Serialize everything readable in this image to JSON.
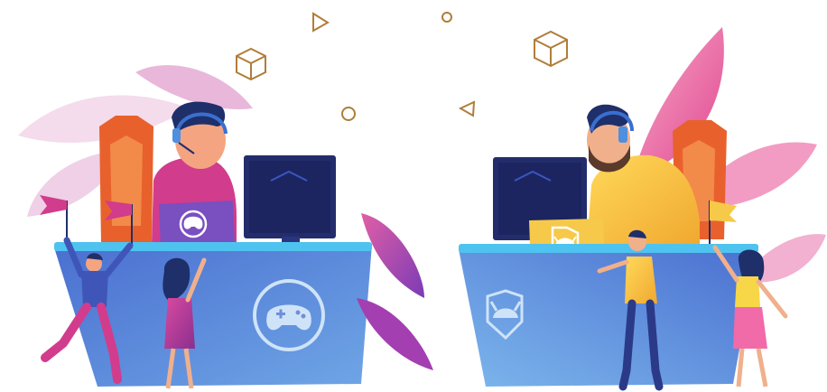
{
  "scene": {
    "description_type": "illustration",
    "teams": [
      {
        "side": "left",
        "emblem": "gamepad-emblem",
        "player": "gamer-magenta-shirt"
      },
      {
        "side": "right",
        "emblem": "viking-helmet-emblem",
        "player": "bearded-gamer-yellow-shirt"
      }
    ],
    "colors": {
      "desk_left": "#5b7fd4",
      "desk_right": "#5a8fd6",
      "desk_top": "#4ec3ef",
      "chair": "#e8612c",
      "monitor": "#232d6b",
      "leaf_pink": "#f06ba8",
      "leaf_purple": "#b04db8",
      "plant_light": "#f2d5ea",
      "accent_gold": "#f7c948",
      "geometry": "#b07d3a"
    }
  }
}
